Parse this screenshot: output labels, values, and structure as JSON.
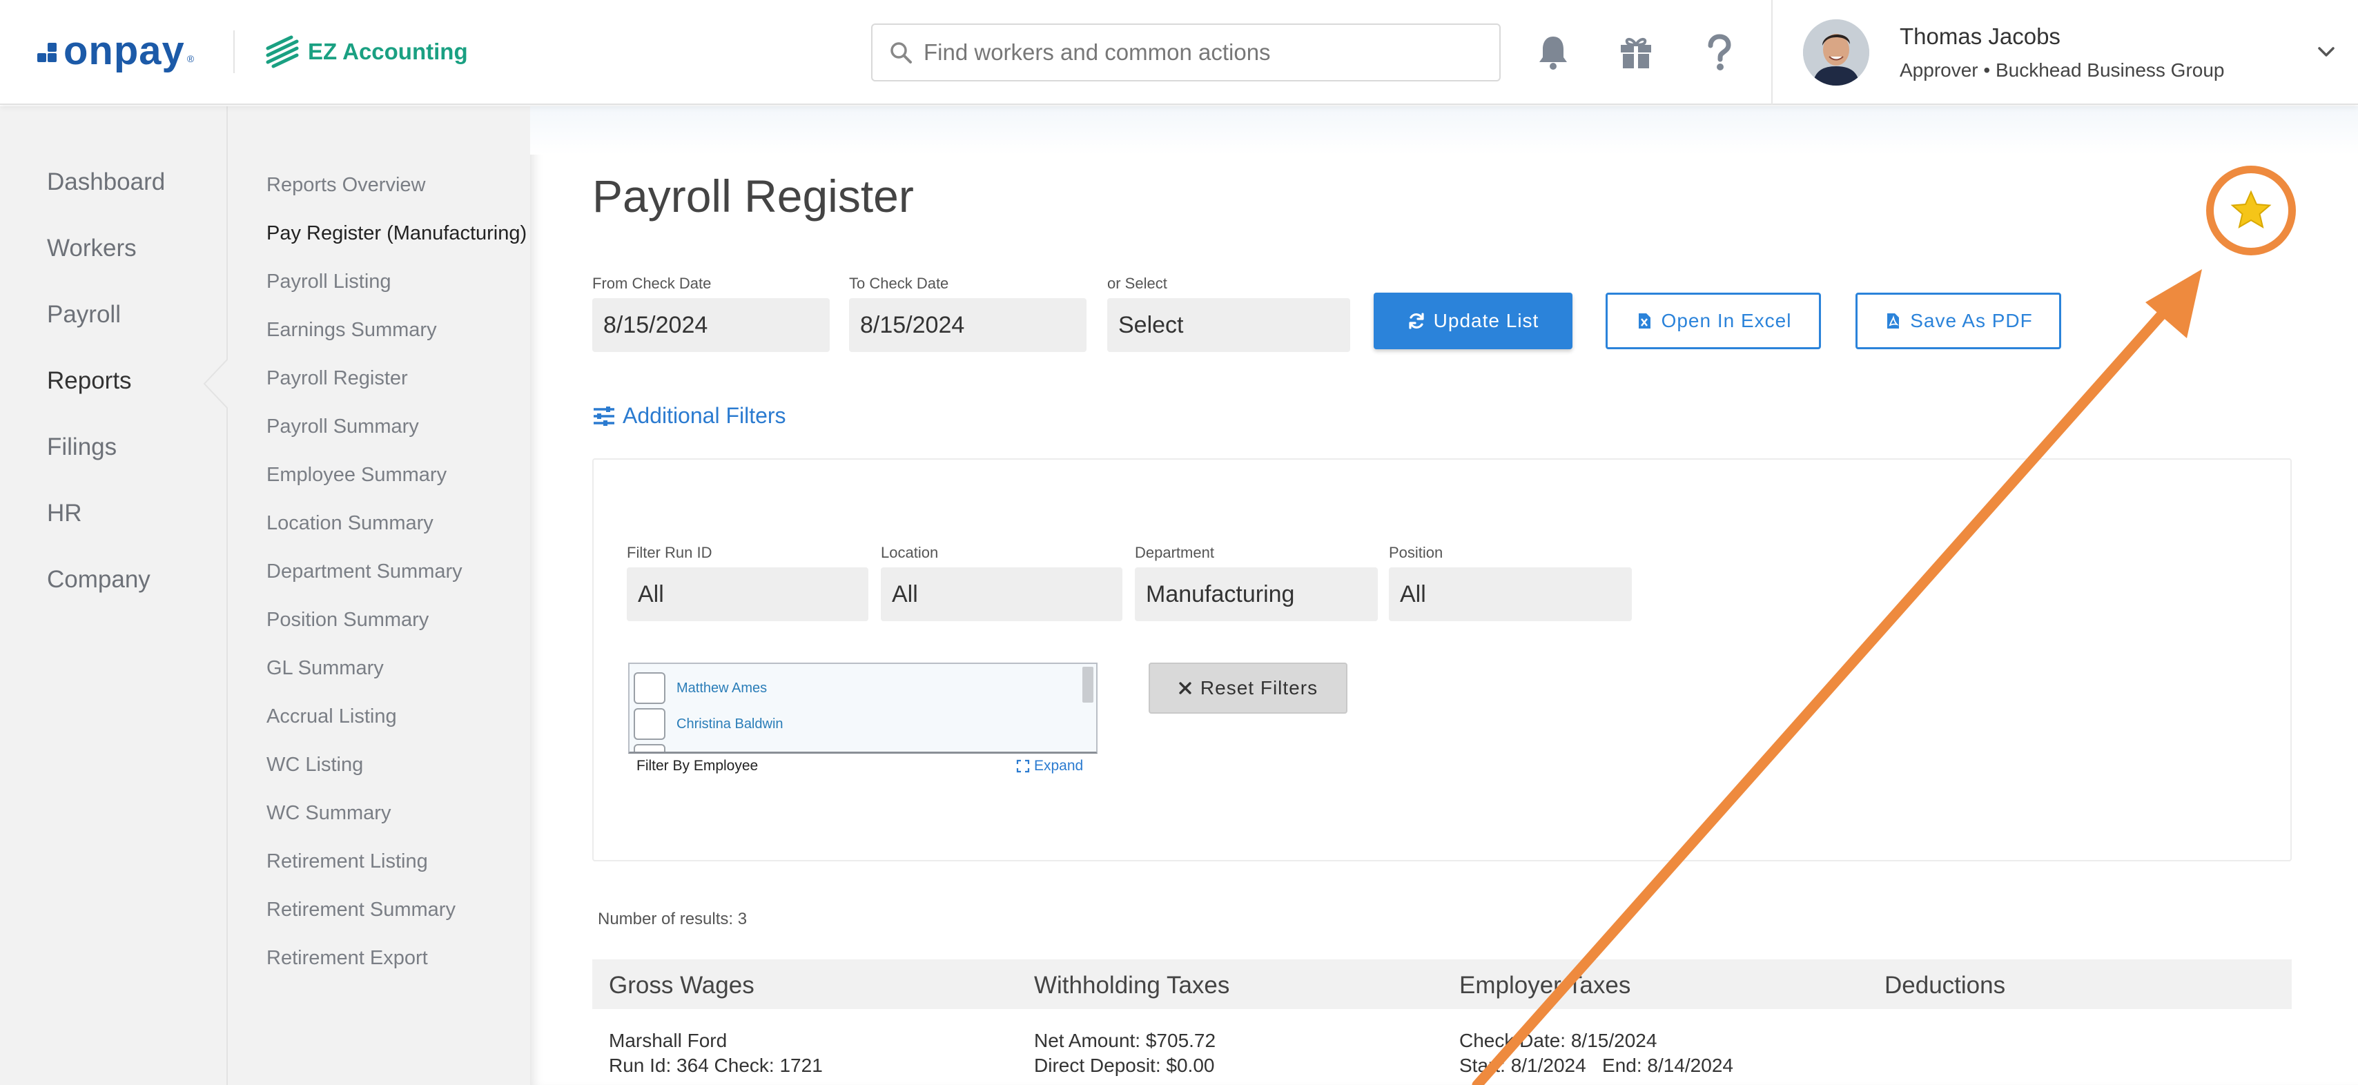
{
  "header": {
    "brand": "onpay",
    "brand_mark": "®",
    "app_name": "EZ Accounting",
    "search_placeholder": "Find workers and common actions",
    "user": {
      "name": "Thomas Jacobs",
      "role": "Approver • Buckhead Business Group"
    },
    "icons": [
      "bell-icon",
      "gift-icon",
      "help-icon",
      "chevron-down-icon"
    ]
  },
  "nav": {
    "items": [
      "Dashboard",
      "Workers",
      "Payroll",
      "Reports",
      "Filings",
      "HR",
      "Company"
    ],
    "active": "Reports"
  },
  "subnav": {
    "items": [
      "Reports Overview",
      "Pay Register (Manufacturing)",
      "Payroll Listing",
      "Earnings Summary",
      "Payroll Register",
      "Payroll Summary",
      "Employee Summary",
      "Location Summary",
      "Department Summary",
      "Position Summary",
      "GL Summary",
      "Accrual Listing",
      "WC Listing",
      "WC Summary",
      "Retirement Listing",
      "Retirement Summary",
      "Retirement Export"
    ],
    "active": "Pay Register (Manufacturing)"
  },
  "page": {
    "title": "Payroll Register",
    "from_label": "From Check Date",
    "from_value": "8/15/2024",
    "to_label": "To Check Date",
    "to_value": "8/15/2024",
    "or_select_label": "or Select",
    "or_select_value": "Select",
    "update_label": "Update List",
    "excel_label": "Open In Excel",
    "pdf_label": "Save As PDF",
    "additional_filters": "Additional Filters",
    "favorite_icon": "star-icon",
    "accent_color": "#2b83da",
    "annotation_color": "#ee8a3e"
  },
  "filters": {
    "run_id_label": "Filter Run ID",
    "run_id_value": "All",
    "location_label": "Location",
    "location_value": "All",
    "department_label": "Department",
    "department_value": "Manufacturing",
    "position_label": "Position",
    "position_value": "All",
    "employees": [
      "Matthew Ames",
      "Christina Baldwin"
    ],
    "employee_filter_label": "Filter By Employee",
    "expand_label": "Expand",
    "reset_label": "Reset Filters"
  },
  "results": {
    "count_text": "Number of results: 3",
    "columns": [
      "Gross Wages",
      "Withholding Taxes",
      "Employer Taxes",
      "Deductions"
    ],
    "first_row": {
      "name": "Marshall Ford",
      "run_check": "Run Id: 364 Check: 1721",
      "net_amount": "Net Amount: $705.72",
      "direct_deposit": "Direct Deposit: $0.00",
      "check_date": "Check Date: 8/15/2024",
      "period": "Start: 8/1/2024   End: 8/14/2024"
    }
  }
}
